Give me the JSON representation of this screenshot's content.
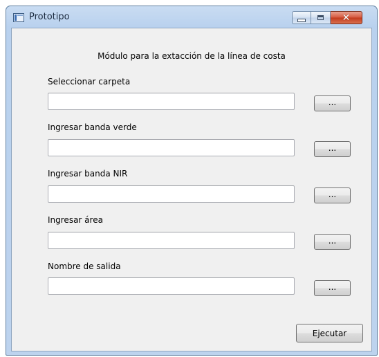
{
  "window": {
    "title": "Prototipo",
    "icon": "app-window-icon",
    "controls": {
      "minimize": "minimize-icon",
      "maximize": "maximize-icon",
      "close": "close-icon",
      "close_glyph": "✕"
    }
  },
  "header": {
    "text": "Módulo para la extacción de la línea de costa"
  },
  "fields": [
    {
      "label": "Seleccionar carpeta",
      "value": "",
      "button_label": "..."
    },
    {
      "label": "Ingresar banda verde",
      "value": "",
      "button_label": "..."
    },
    {
      "label": "Ingresar banda NIR",
      "value": "",
      "button_label": "..."
    },
    {
      "label": "Ingresar área",
      "value": "",
      "button_label": "..."
    },
    {
      "label": "Nombre de salida",
      "value": "",
      "button_label": "..."
    }
  ],
  "actions": {
    "run_label": "Ejecutar"
  },
  "colors": {
    "titlebar": "#bdd3ee",
    "client_bg": "#f0f0f0",
    "close_button": "#c23a1d"
  }
}
